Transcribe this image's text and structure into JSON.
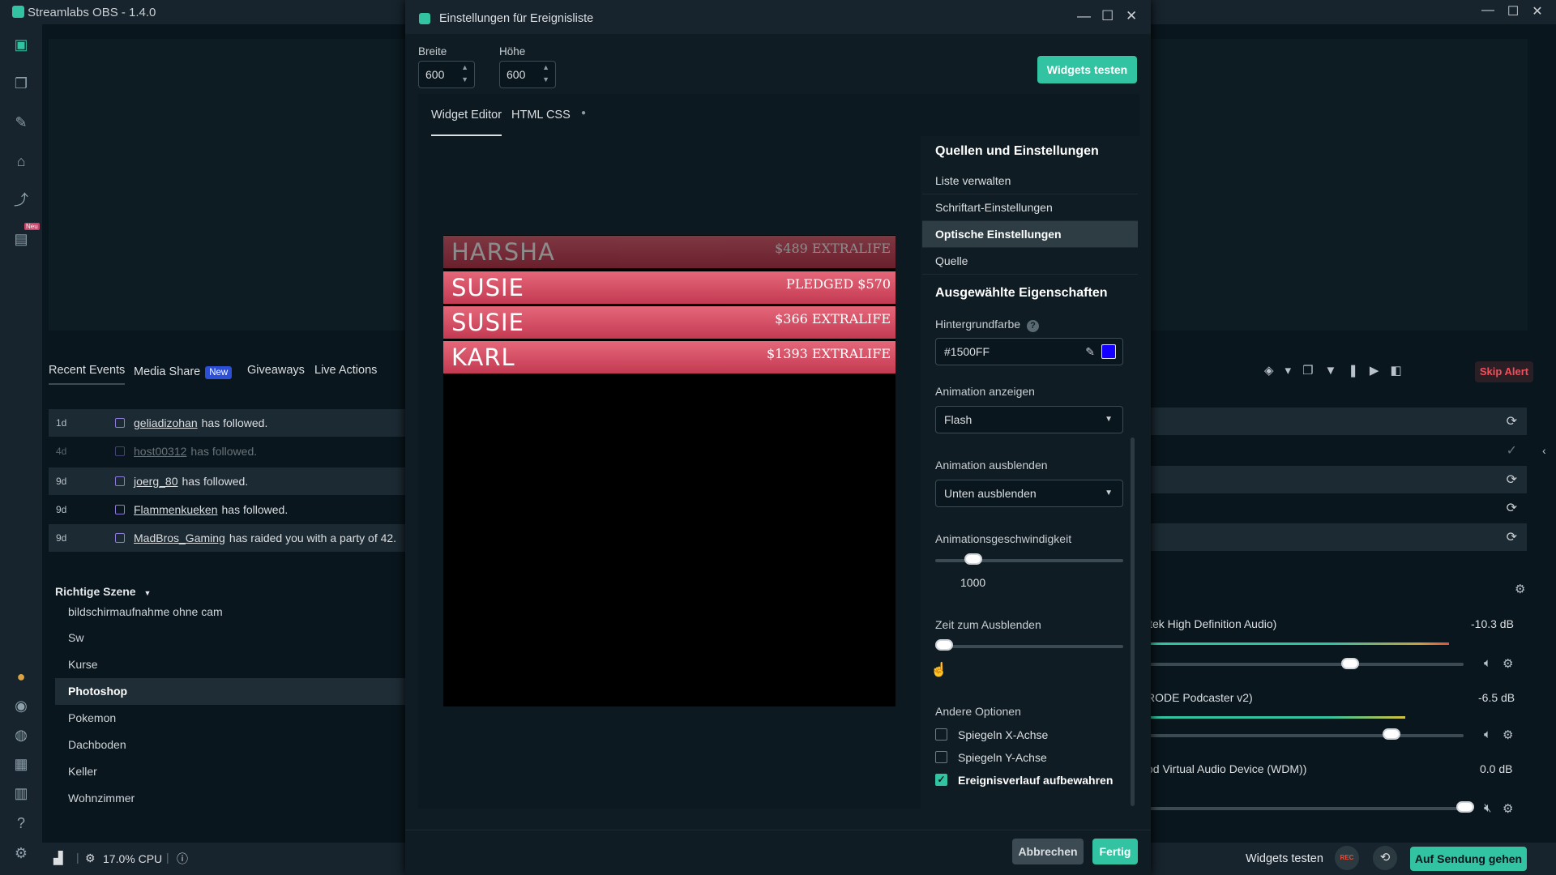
{
  "app": {
    "title": "Streamlabs OBS - 1.4.0",
    "accent": "#31c3a2"
  },
  "nav": {
    "new_badge": "Neu"
  },
  "recent_events": {
    "tabs": [
      {
        "label": "Recent Events"
      },
      {
        "label": "Media Share",
        "badge": "New"
      },
      {
        "label": "Giveaways"
      },
      {
        "label": "Live Actions"
      }
    ],
    "rows": [
      {
        "age": "1d",
        "user": "geliadizohan",
        "text": "has followed."
      },
      {
        "age": "4d",
        "user": "host00312",
        "text": "has followed."
      },
      {
        "age": "9d",
        "user": "joerg_80",
        "text": "has followed."
      },
      {
        "age": "9d",
        "user": "Flammenkueken",
        "text": "has followed."
      },
      {
        "age": "9d",
        "user": "MadBros_Gaming",
        "text": "has raided you with a party of 42."
      }
    ]
  },
  "scenes": {
    "header": "Richtige Szene",
    "items": [
      "bildschirmaufnahme ohne cam",
      "Sw",
      "Kurse",
      "Photoshop",
      "Pokemon",
      "Dachboden",
      "Keller",
      "Wohnzimmer"
    ],
    "selected": "Photoshop"
  },
  "mixer": {
    "devices": [
      {
        "name": "ltek High Definition Audio)",
        "db": "-10.3 dB"
      },
      {
        "name": "RODE Podcaster v2)",
        "db": "-6.5 dB"
      },
      {
        "name": "od Virtual Audio Device (WDM))",
        "db": "0.0 dB"
      }
    ],
    "skip_alert": "Skip Alert"
  },
  "bottom": {
    "cpu": "17.0% CPU",
    "widgets_test": "Widgets testen",
    "rec": "REC",
    "go_live": "Auf Sendung gehen"
  },
  "dialog": {
    "title": "Einstellungen für Ereignisliste",
    "width_label": "Breite",
    "width_value": "600",
    "height_label": "Höhe",
    "height_value": "600",
    "test_button": "Widgets testen",
    "tabs": [
      "Widget Editor",
      "HTML CSS"
    ],
    "preview_events": [
      {
        "name": "HARSHA",
        "amount": "$489 EXTRALIFE"
      },
      {
        "name": "SUSIE",
        "amount": "PLEDGED $570"
      },
      {
        "name": "SUSIE",
        "amount": "$366 EXTRALIFE"
      },
      {
        "name": "KARL",
        "amount": "$1393 EXTRALIFE"
      }
    ],
    "panel": {
      "sources_header": "Quellen und Einstellungen",
      "items": [
        "Liste verwalten",
        "Schriftart-Einstellungen",
        "Optische Einstellungen",
        "Quelle"
      ],
      "selected_item": "Optische Einstellungen",
      "props_header": "Ausgewählte Eigenschaften",
      "bg_label": "Hintergrundfarbe",
      "bg_value": "#1500FF",
      "show_anim_label": "Animation anzeigen",
      "show_anim_value": "Flash",
      "hide_anim_label": "Animation ausblenden",
      "hide_anim_value": "Unten ausblenden",
      "speed_label": "Animationsgeschwindigkeit",
      "speed_value": "1000",
      "speed_fraction": 0.17,
      "fade_label": "Zeit zum Ausblenden",
      "fade_fraction": 0.0,
      "other_label": "Andere Optionen",
      "options": [
        {
          "label": "Spiegeln X-Achse",
          "checked": false
        },
        {
          "label": "Spiegeln Y-Achse",
          "checked": false
        },
        {
          "label": "Ereignisverlauf aufbewahren",
          "checked": true
        }
      ]
    },
    "cancel": "Abbrechen",
    "done": "Fertig"
  }
}
